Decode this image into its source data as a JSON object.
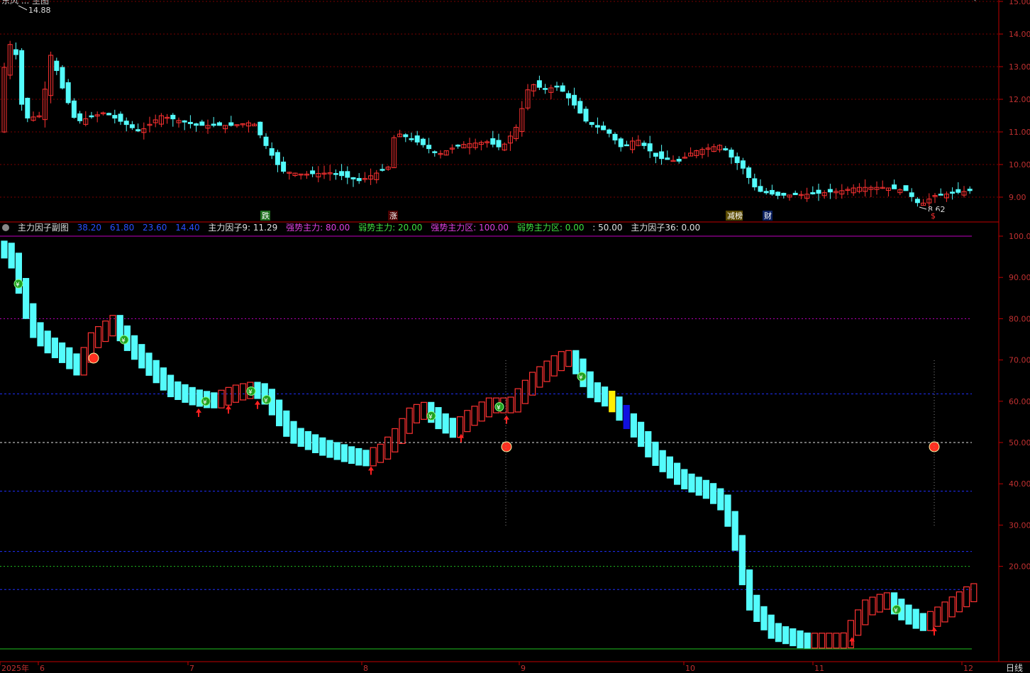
{
  "window": {
    "title_cropped": "东风 ... 主图"
  },
  "price_panel": {
    "y_ticks": [
      "15.00",
      "14.00",
      "13.00",
      "12.00",
      "11.00",
      "10.00",
      "9.00"
    ],
    "high_label": "14.88",
    "low_label": "8.62",
    "event_tags": [
      {
        "text": "跌",
        "bg": "#1f6f1f",
        "fg": "#fff"
      },
      {
        "text": "涨",
        "bg": "#4a0000",
        "fg": "#fff"
      },
      {
        "text": "减榜",
        "bg": "#5a4a00",
        "fg": "#fff"
      },
      {
        "text": "财",
        "bg": "#0a1f60",
        "fg": "#fff"
      },
      {
        "text": "$",
        "bg": "#000",
        "fg": "#ff3030"
      }
    ]
  },
  "indicator_legend": {
    "name": "主力因子副图",
    "values": [
      {
        "text": "38.20",
        "color": "#2a4fff"
      },
      {
        "text": "61.80",
        "color": "#2a4fff"
      },
      {
        "text": "23.60",
        "color": "#2a4fff"
      },
      {
        "text": "14.40",
        "color": "#2a4fff"
      },
      {
        "text": "主力因子9: 11.29",
        "color": "#e0e0e0"
      },
      {
        "text": "强势主力: 80.00",
        "color": "#e040e0"
      },
      {
        "text": "弱势主力: 20.00",
        "color": "#40e040"
      },
      {
        "text": "强势主力区: 100.00",
        "color": "#e040e0"
      },
      {
        "text": "弱势主力区: 0.00",
        "color": "#40e040"
      },
      {
        "text": ": 50.00",
        "color": "#e0e0e0"
      },
      {
        "text": "主力因子36: 0.00",
        "color": "#e0e0e0"
      }
    ]
  },
  "indicator_panel": {
    "y_ticks": [
      "100.00",
      "90.00",
      "80.00",
      "70.00",
      "60.00",
      "50.00",
      "40.00",
      "30.00",
      "20.00"
    ]
  },
  "x_axis": {
    "labels": [
      "2025年",
      "6",
      "7",
      "8",
      "9",
      "10",
      "11",
      "12"
    ],
    "period": "日线"
  },
  "colors": {
    "up": "#ff3232",
    "down": "#54fcfc",
    "grid_red": "#7a0000",
    "axis": "#c00000"
  }
}
